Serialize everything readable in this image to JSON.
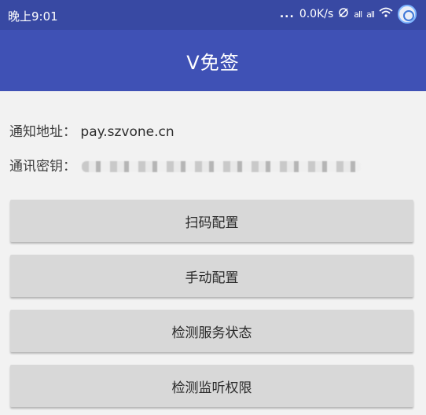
{
  "status_bar": {
    "time": "晚上9:01",
    "dots": "...",
    "network_speed": "0.0K/s",
    "signal_text": "all",
    "battery_indicator": "all",
    "wifi_icon": "wifi-icon",
    "app_icon": "floating-bubble-icon"
  },
  "app_bar": {
    "title": "V免签"
  },
  "info": {
    "notify_label": "通知地址：",
    "notify_value": "pay.szvone.cn",
    "secret_label": "通讯密钥："
  },
  "buttons": {
    "scan_config": "扫码配置",
    "manual_config": "手动配置",
    "check_service": "检测服务状态",
    "check_permission": "检测监听权限"
  },
  "colors": {
    "status_bar_bg": "#3849a3",
    "app_bar_bg": "#3f51b5",
    "page_bg": "#f2f2f2",
    "button_bg": "#d8d8d8"
  }
}
